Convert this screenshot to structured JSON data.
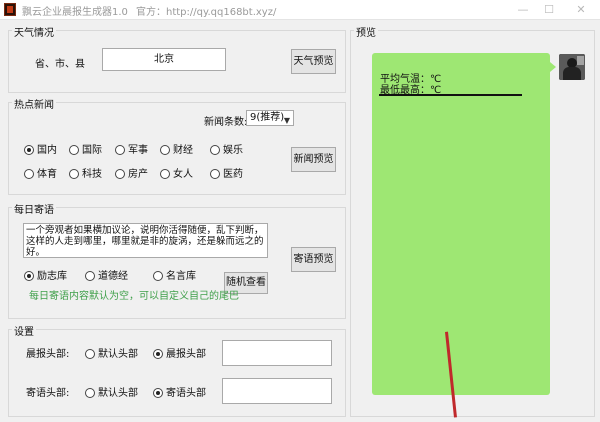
{
  "window": {
    "title": "飘云企业晨报生成器1.0",
    "official_site": "官方：http://qy.qq168bt.xyz/",
    "minimize": "—",
    "maximize": "☐",
    "close": "✕"
  },
  "weather": {
    "legend": "天气情况",
    "location_label": "省、市、县",
    "location_value": "北京",
    "preview_button": "天气预览"
  },
  "news": {
    "legend": "热点新闻",
    "count_label": "新闻条数:",
    "count_value": "9(推荐)",
    "categories": [
      "国内",
      "国际",
      "军事",
      "财经",
      "娱乐",
      "体育",
      "科技",
      "房产",
      "女人",
      "医药"
    ],
    "selected": "国内",
    "preview_button": "新闻预览"
  },
  "daily": {
    "legend": "每日寄语",
    "text": "一个旁观者如果横加议论，说明你活得随便，乱下判断，这样的人走到哪里，哪里就是非的旋涡，还是躲而远之的好。",
    "options": [
      "励志库",
      "道德经",
      "名言库"
    ],
    "selected": "励志库",
    "random_button": "随机查看",
    "preview_button": "寄语预览",
    "hint": "每日寄语内容默认为空，可以自定义自己的尾巴"
  },
  "settings": {
    "legend": "设置",
    "morning_header_label": "晨报头部:",
    "morning_options": [
      "默认头部",
      "晨报头部"
    ],
    "morning_selected": "晨报头部",
    "message_header_label": "寄语头部:",
    "message_options": [
      "默认头部",
      "寄语头部"
    ],
    "message_selected": "寄语头部"
  },
  "preview": {
    "legend": "预览",
    "line1": "平均气温：℃",
    "line2": "最低最高：℃",
    "bubble_color": "#9ee773"
  },
  "colors": {
    "hint": "#3fa04a",
    "annotation_arrow": "#c0292b"
  }
}
